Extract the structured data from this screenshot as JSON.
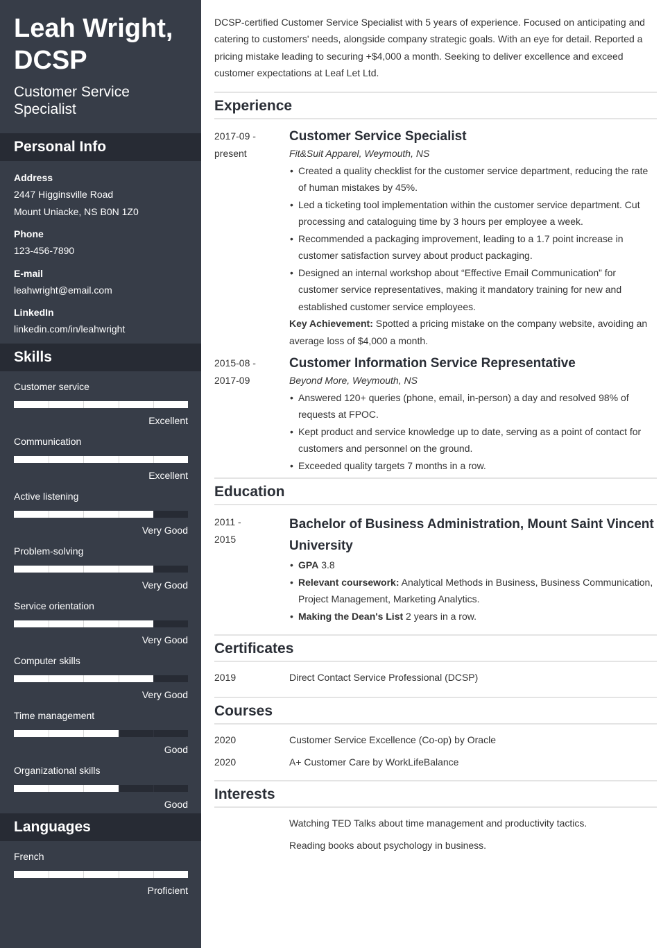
{
  "header": {
    "name": "Leah Wright, DCSP",
    "name_line1": "Leah Wright,",
    "name_line2": "DCSP",
    "title_line1": "Customer Service",
    "title_line2": "Specialist"
  },
  "personal_info": {
    "heading": "Personal Info",
    "address_label": "Address",
    "address_line1": "2447 Higginsville Road",
    "address_line2": "Mount Uniacke, NS B0N 1Z0",
    "phone_label": "Phone",
    "phone": "123-456-7890",
    "email_label": "E-mail",
    "email": "leahwright@email.com",
    "linkedin_label": "LinkedIn",
    "linkedin": "linkedin.com/in/leahwright"
  },
  "skills": {
    "heading": "Skills",
    "items": [
      {
        "name": "Customer service",
        "level": "Excellent",
        "rating": 5,
        "max": 5
      },
      {
        "name": "Communication",
        "level": "Excellent",
        "rating": 5,
        "max": 5
      },
      {
        "name": "Active listening",
        "level": "Very Good",
        "rating": 4,
        "max": 5
      },
      {
        "name": "Problem-solving",
        "level": "Very Good",
        "rating": 4,
        "max": 5
      },
      {
        "name": "Service orientation",
        "level": "Very Good",
        "rating": 4,
        "max": 5
      },
      {
        "name": "Computer skills",
        "level": "Very Good",
        "rating": 4,
        "max": 5
      },
      {
        "name": "Time management",
        "level": "Good",
        "rating": 3,
        "max": 5
      },
      {
        "name": "Organizational skills",
        "level": "Good",
        "rating": 3,
        "max": 5
      }
    ]
  },
  "languages": {
    "heading": "Languages",
    "items": [
      {
        "name": "French",
        "level": "Proficient",
        "rating": 5,
        "max": 5
      }
    ]
  },
  "summary": "DCSP-certified Customer Service Specialist with 5 years of experience. Focused on anticipating and catering to customers' needs, alongside company strategic goals. With an eye for detail. Reported a pricing mistake leading to securing +$4,000 a month. Seeking to deliver excellence and exceed customer expectations at Leaf Let Ltd.",
  "experience": {
    "heading": "Experience",
    "jobs": [
      {
        "date_line1": "2017-09 -",
        "date_line2": "present",
        "title": "Customer Service Specialist",
        "company": "Fit&Suit Apparel, Weymouth, NS",
        "bullets": [
          "Created a quality checklist for the customer service department, reducing the rate of human mistakes by 45%.",
          "Led a ticketing tool implementation within the customer service department. Cut processing and cataloguing time by 3 hours per employee a week.",
          "Recommended a packaging improvement, leading to a 1.7 point increase in customer satisfaction survey about product packaging.",
          "Designed an internal workshop about “Effective Email Communication” for customer service representatives, making it mandatory training for new and established customer service employees."
        ],
        "achievement_label": "Key Achievement:",
        "achievement": " Spotted a pricing mistake on the company website, avoiding an average loss of $4,000 a month."
      },
      {
        "date_line1": "2015-08 -",
        "date_line2": "2017-09",
        "title": "Customer Information Service Representative",
        "company": "Beyond More, Weymouth, NS",
        "bullets": [
          "Answered 120+ queries (phone, email, in-person) a day and resolved 98% of requests at FPOC.",
          "Kept product and service knowledge up to date, serving as a point of contact for customers and personnel on the ground.",
          "Exceeded quality targets 7 months in a row."
        ]
      }
    ]
  },
  "education": {
    "heading": "Education",
    "date_line1": "2011 -",
    "date_line2": "2015",
    "degree": "Bachelor of Business Administration, Mount Saint Vincent University",
    "gpa_label": "GPA",
    "gpa": " 3.8",
    "coursework_label": "Relevant coursework:",
    "coursework": " Analytical Methods in Business, Business Communication, Project Management, Marketing Analytics.",
    "deans_label": "Making the Dean's List",
    "deans": " 2 years in a row."
  },
  "certificates": {
    "heading": "Certificates",
    "items": [
      {
        "year": "2019",
        "name": "Direct Contact Service Professional (DCSP)"
      }
    ]
  },
  "courses": {
    "heading": "Courses",
    "items": [
      {
        "year": "2020",
        "name": "Customer Service Excellence (Co-op) by Oracle"
      },
      {
        "year": "2020",
        "name": "A+ Customer Care by WorkLifeBalance"
      }
    ]
  },
  "interests": {
    "heading": "Interests",
    "items": [
      "Watching TED Talks about time management and productivity tactics.",
      "Reading books about psychology in business."
    ]
  }
}
